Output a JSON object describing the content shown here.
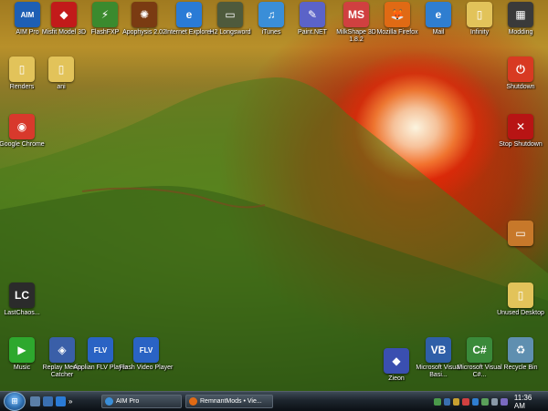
{
  "desktop_icons": [
    {
      "label": "AIM Pro",
      "glyph": "AIM",
      "icon": "aim-pro-icon",
      "color": "#1e5fb4"
    },
    {
      "label": "Misfit Model 3D",
      "glyph": "◆",
      "icon": "misfit-model-3d-icon",
      "color": "#c21a1a"
    },
    {
      "label": "FlashFXP",
      "glyph": "⚡",
      "icon": "flashfxp-icon",
      "color": "#3b8a2e"
    },
    {
      "label": "Apophysis 2.02",
      "glyph": "✺",
      "icon": "apophysis-icon",
      "color": "#7a3b12"
    },
    {
      "label": "Internet Explorer",
      "glyph": "e",
      "icon": "internet-explorer-icon",
      "color": "#2a7bd6"
    },
    {
      "label": "H2 Longsword",
      "glyph": "▭",
      "icon": "h2-longsword-icon",
      "color": "#4e5a3c"
    },
    {
      "label": "iTunes",
      "glyph": "♫",
      "icon": "itunes-icon",
      "color": "#3a8ed8"
    },
    {
      "label": "Paint.NET",
      "glyph": "✎",
      "icon": "paint-net-icon",
      "color": "#5b63c8"
    },
    {
      "label": "MilkShape 3D 1.8.2",
      "glyph": "MS",
      "icon": "milkshape-3d-icon",
      "color": "#d04040"
    },
    {
      "label": "Mozilla Firefox",
      "glyph": "🦊",
      "icon": "firefox-icon",
      "color": "#e06a14"
    },
    {
      "label": "Mail",
      "glyph": "e",
      "icon": "mail-icon",
      "color": "#2f7ed0"
    },
    {
      "label": "Infinity",
      "glyph": "▯",
      "icon": "infinity-folder-icon",
      "color": "#e2c35a"
    },
    {
      "label": "Modding",
      "glyph": "▦",
      "icon": "modding-icon",
      "color": "#3a3a3a"
    },
    {
      "label": "Renders",
      "glyph": "▯",
      "icon": "renders-folder-icon",
      "color": "#e2c35a"
    },
    {
      "label": "ani",
      "glyph": "▯",
      "icon": "ani-folder-icon",
      "color": "#e2c35a"
    },
    {
      "label": "Google Chrome",
      "glyph": "◉",
      "icon": "chrome-icon",
      "color": "#d8392c"
    },
    {
      "label": "Shutdown",
      "glyph": "⏻",
      "icon": "shutdown-icon",
      "color": "#d83a22"
    },
    {
      "label": "Stop Shutdown",
      "glyph": "✕",
      "icon": "stop-shutdown-icon",
      "color": "#b81414"
    },
    {
      "label": "",
      "glyph": "▭",
      "icon": "briefcase-icon",
      "color": "#c7782a"
    },
    {
      "label": "LastChaos...",
      "glyph": "LC",
      "icon": "lastchaos-icon",
      "color": "#2b2b2b"
    },
    {
      "label": "Unused Desktop",
      "glyph": "▯",
      "icon": "unused-desktop-folder-icon",
      "color": "#e2c35a"
    },
    {
      "label": "Music",
      "glyph": "▶",
      "icon": "music-icon",
      "color": "#2ea82e"
    },
    {
      "label": "Replay Media Catcher",
      "glyph": "◈",
      "icon": "replay-media-catcher-icon",
      "color": "#3a5fa8"
    },
    {
      "label": "Applian FLV Player",
      "glyph": "FLV",
      "icon": "applian-flv-player-icon",
      "color": "#2a63c4"
    },
    {
      "label": "Flash Video Player",
      "glyph": "FLV",
      "icon": "flash-video-player-icon",
      "color": "#2a63c4"
    },
    {
      "label": "Zieon",
      "glyph": "◆",
      "icon": "zieon-icon",
      "color": "#3a4fb0"
    },
    {
      "label": "Microsoft Visual Basi...",
      "glyph": "VB",
      "icon": "visual-basic-icon",
      "color": "#2f5fa8"
    },
    {
      "label": "Microsoft Visual C#...",
      "glyph": "C#",
      "icon": "visual-csharp-icon",
      "color": "#3a8a3a"
    },
    {
      "label": "Recycle Bin",
      "glyph": "♻",
      "icon": "recycle-bin-icon",
      "color": "#5f8fb0"
    }
  ],
  "taskbar": {
    "quick_launch_icons": [
      "show-desktop-icon",
      "switch-windows-icon",
      "internet-explorer-icon",
      "more-icon"
    ],
    "tasks": [
      {
        "label": "AIM Pro",
        "icon": "aim-pro-icon",
        "color": "#3a8ed8"
      },
      {
        "label": "RemnantMods • Vie...",
        "icon": "firefox-icon",
        "color": "#e06a14"
      }
    ],
    "clock": "11:36 AM"
  }
}
